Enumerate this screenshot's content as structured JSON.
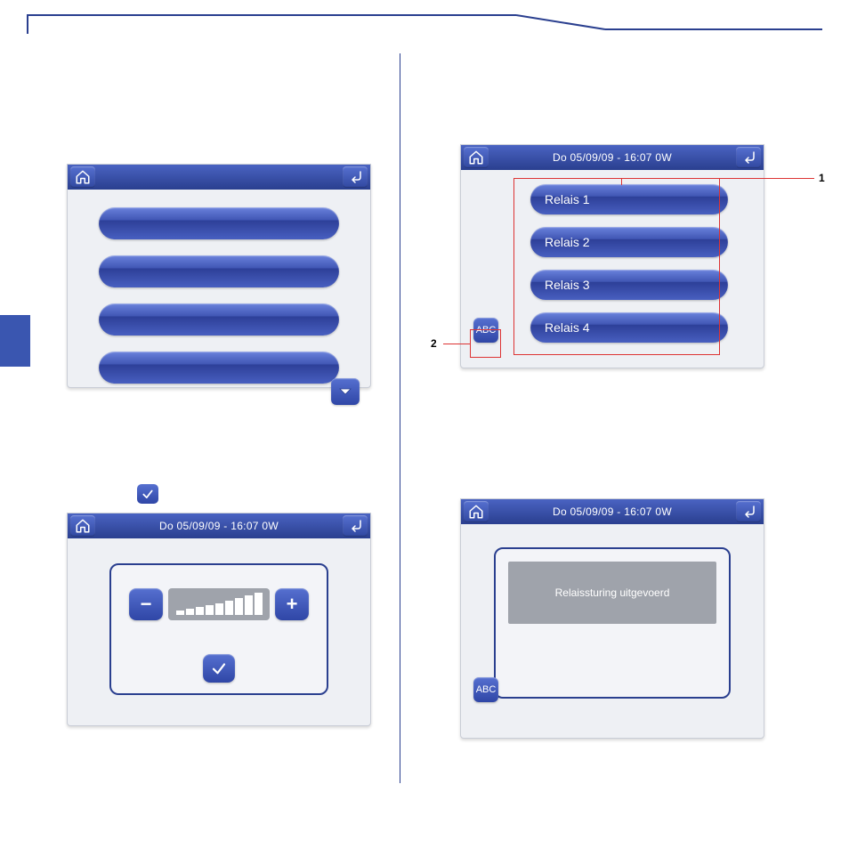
{
  "header_datetime": "Do 05/09/09 - 16:07   0W",
  "abc_label": "ABC",
  "callouts": {
    "one": "1",
    "two": "2"
  },
  "panel1": {
    "items": [
      "",
      "",
      "",
      ""
    ]
  },
  "panel2": {
    "items": [
      "Relais 1",
      "Relais 2",
      "Relais 3",
      "Relais 4"
    ]
  },
  "panel3": {
    "minus": "−",
    "plus": "+"
  },
  "panel4": {
    "message": "Relaissturing uitgevoerd"
  }
}
